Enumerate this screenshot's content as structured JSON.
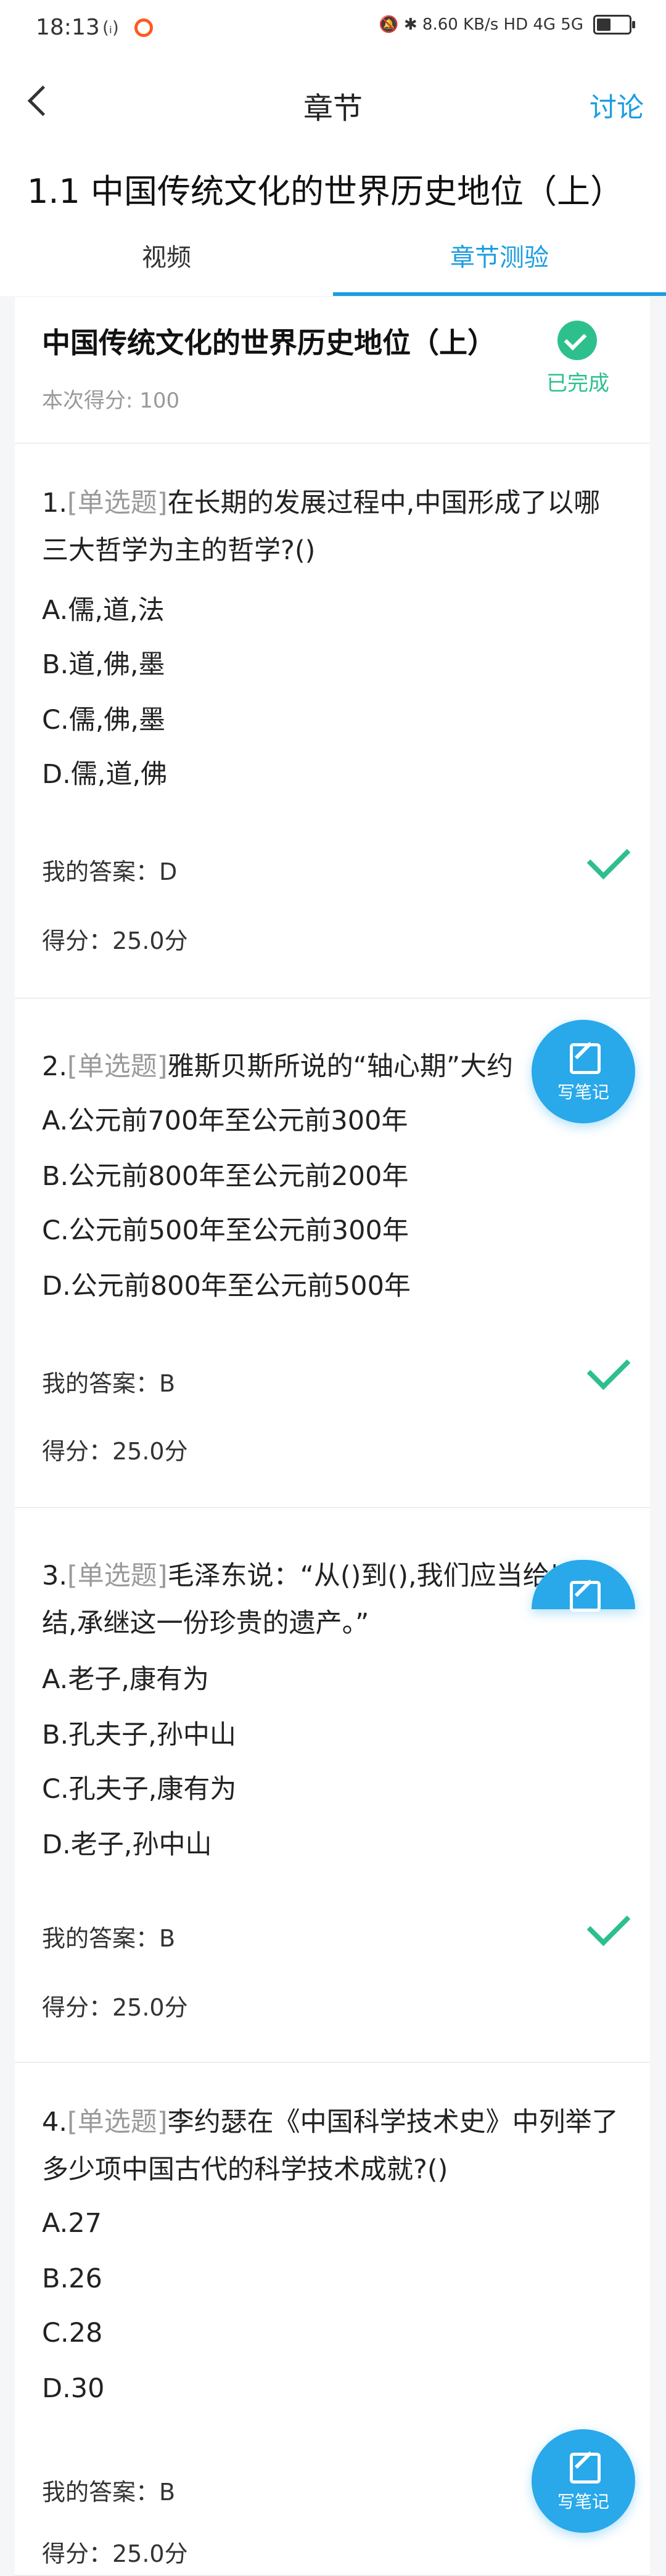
{
  "status_bar": {
    "time": "18:13",
    "sys_icons": "(ᵢ)",
    "right_icons": "🔕 ✱ 8.60 KB/s HD 4G 5G"
  },
  "nav": {
    "title": "章节",
    "action": "讨论"
  },
  "chapter": {
    "title": "1.1 中国传统文化的世界历史地位（上）"
  },
  "tabs": [
    {
      "label": "视频"
    },
    {
      "label": "章节测验"
    }
  ],
  "summary": {
    "title": "中国传统文化的世界历史地位（上）",
    "score": "本次得分: 100",
    "status": "已完成"
  },
  "questions": [
    {
      "num": "1.",
      "type": "[单选题]",
      "stem": "在长期的发展过程中,中国形成了以哪三大哲学为主的哲学?()",
      "options": [
        "A.儒,道,法",
        "B.道,佛,墨",
        "C.儒,佛,墨",
        "D.儒,道,佛"
      ],
      "answer": "我的答案：D",
      "score": "得分：25.0分"
    },
    {
      "num": "2.",
      "type": "[单选题]",
      "stem": "雅斯贝斯所说的“轴心期”大约",
      "options": [
        "A.公元前700年至公元前300年",
        "B.公元前800年至公元前200年",
        "C.公元前500年至公元前300年",
        "D.公元前800年至公元前500年"
      ],
      "answer": "我的答案：B",
      "score": "得分：25.0分"
    },
    {
      "num": "3.",
      "type": "[单选题]",
      "stem": "毛泽东说：“从()到(),我们应当给以总结,承继这一份珍贵的遗产。”",
      "options": [
        "A.老子,康有为",
        "B.孔夫子,孙中山",
        "C.孔夫子,康有为",
        "D.老子,孙中山"
      ],
      "answer": "我的答案：B",
      "score": "得分：25.0分"
    },
    {
      "num": "4.",
      "type": "[单选题]",
      "stem": "李约瑟在《中国科学技术史》中列举了多少项中国古代的科学技术成就?()",
      "options": [
        "A.27",
        "B.26",
        "C.28",
        "D.30"
      ],
      "answer": "我的答案：B",
      "score": "得分：25.0分"
    }
  ],
  "note_button": {
    "label": "写笔记"
  },
  "colors": {
    "accent": "#1a9de0",
    "success": "#2dc08d",
    "note": "#29a8ea"
  }
}
